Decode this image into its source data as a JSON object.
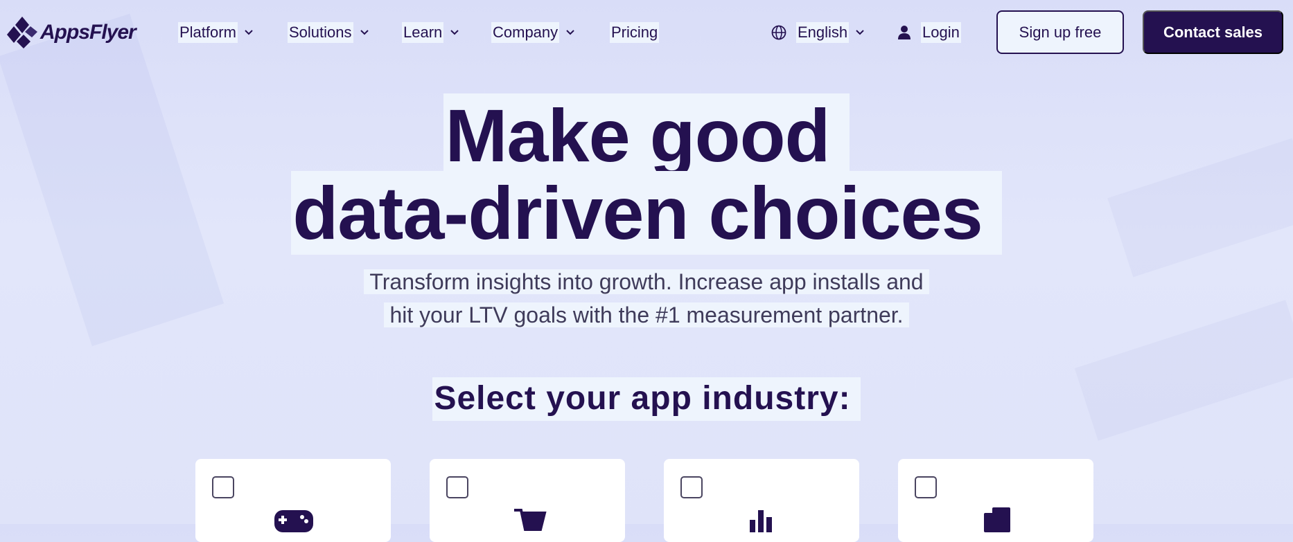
{
  "brand": {
    "name": "AppsFlyer",
    "color": "#241150"
  },
  "nav": {
    "items": [
      {
        "label": "Platform",
        "has_dropdown": true
      },
      {
        "label": "Solutions",
        "has_dropdown": true
      },
      {
        "label": "Learn",
        "has_dropdown": true
      },
      {
        "label": "Company",
        "has_dropdown": true
      },
      {
        "label": "Pricing",
        "has_dropdown": false
      }
    ],
    "language": {
      "label": "English",
      "icon": "globe-icon"
    },
    "login": {
      "label": "Login",
      "icon": "user-icon"
    },
    "signup_label": "Sign up free",
    "contact_label": "Contact sales"
  },
  "hero": {
    "title_line1": "Make good",
    "title_line2": "data-driven choices",
    "subtitle_line1": "Transform insights into growth. Increase app installs and",
    "subtitle_line2": "hit your LTV goals with the #1 measurement partner."
  },
  "industry": {
    "title": "Select your app industry:",
    "cards": [
      {
        "icon": "gamepad-icon",
        "checked": false
      },
      {
        "icon": "shopping-cart-icon",
        "checked": false
      },
      {
        "icon": "bar-chart-icon",
        "checked": false
      },
      {
        "icon": "building-icon",
        "checked": false
      }
    ]
  }
}
